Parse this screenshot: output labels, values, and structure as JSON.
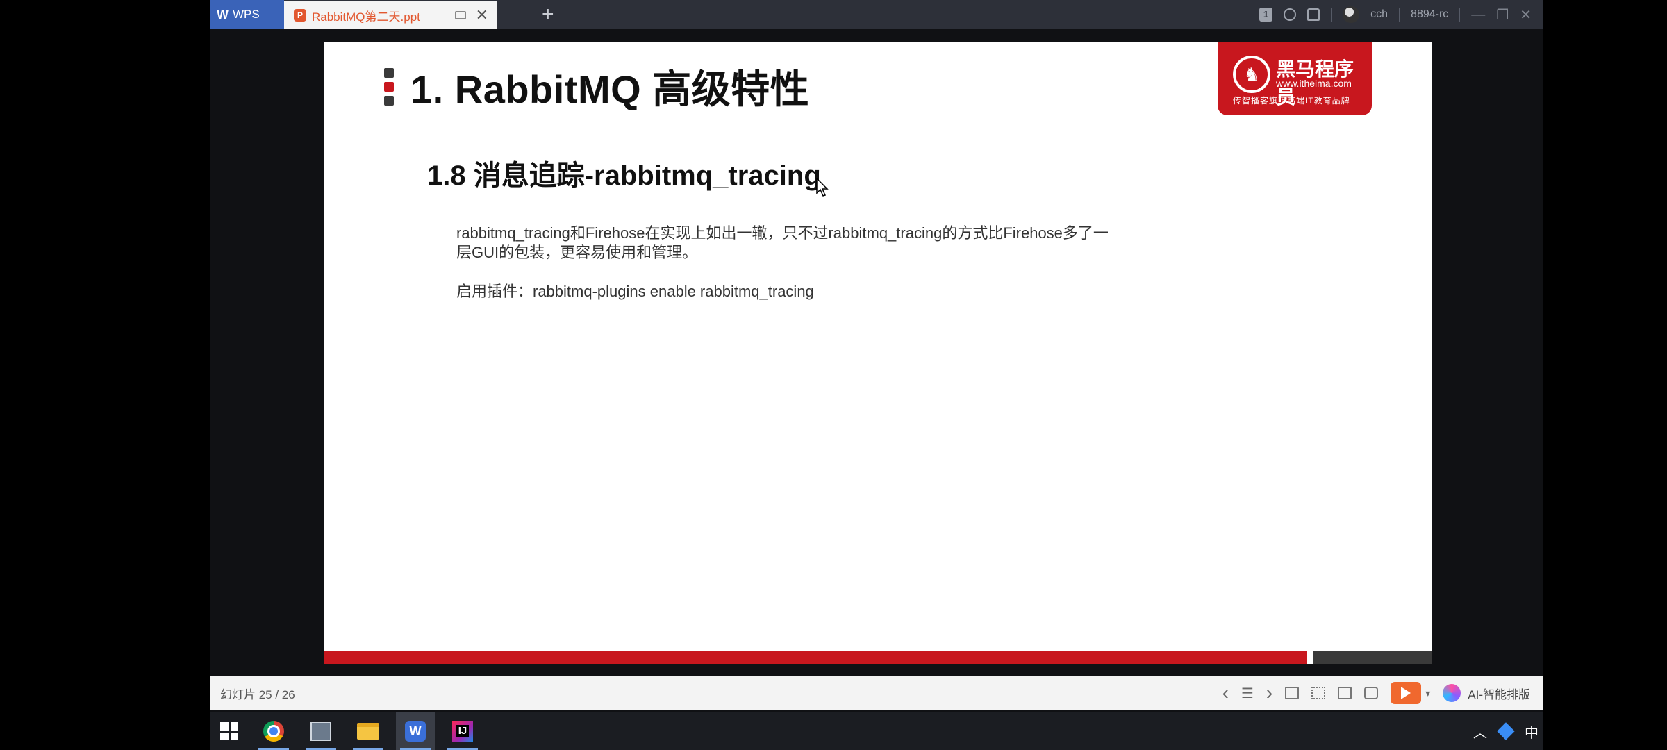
{
  "titlebar": {
    "app_name": "WPS",
    "document_tab": "RabbitMQ第二天.ppt",
    "close_glyph": "✕",
    "new_tab_glyph": "+",
    "page_indicator": "1",
    "user_name": "cch",
    "user_id": "8894-rc",
    "minimize_glyph": "—",
    "restore_glyph": "❐",
    "close_window_glyph": "✕"
  },
  "slide": {
    "title": "1. RabbitMQ 高级特性",
    "subtitle": "1.8 消息追踪-rabbitmq_tracing",
    "paragraph_line1": "rabbitmq_tracing和Firehose在实现上如出一辙，只不过rabbitmq_tracing的方式比Firehose多了一",
    "paragraph_line2": "层GUI的包装，更容易使用和管理。",
    "plugin_line": "启用插件：rabbitmq-plugins enable rabbitmq_tracing",
    "logo": {
      "name": "黑马程序员",
      "url": "www.itheima.com",
      "slogan": "传智播客旗下高端IT教育品牌"
    },
    "colors": {
      "accent_red": "#c8171e",
      "bar_dark": "#3a3a3a"
    }
  },
  "statusbar": {
    "slide_counter": "幻灯片 25 / 26",
    "ai_label": "AI-智能排版",
    "prev_glyph": "‹",
    "next_glyph": "›",
    "list_glyph": "☰",
    "dropdown_glyph": "▾"
  },
  "taskbar": {
    "tray_caret": "︿",
    "input_method": "中",
    "wps_letter": "W",
    "idea_letters": "IJ"
  }
}
